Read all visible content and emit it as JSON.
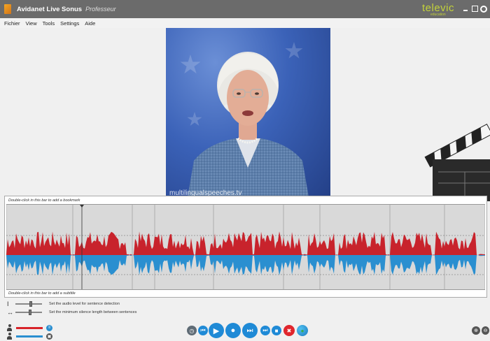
{
  "window": {
    "app_name": "Avidanet Live Sonus",
    "role": "Professeur",
    "brand": "televic",
    "brand_sub": "education"
  },
  "menu": [
    {
      "label": "Fichier"
    },
    {
      "label": "View"
    },
    {
      "label": "Tools"
    },
    {
      "label": "Settings"
    },
    {
      "label": "Aide"
    }
  ],
  "video": {
    "watermark": "multilingualspeeches.tv"
  },
  "waveform": {
    "bookmark_hint": "Double-click in this bar to add a bookmark",
    "subtitle_hint": "Double-click in this bar to add a subtitle"
  },
  "controls": {
    "audio_level_label": "Set the audio level for sentence detection",
    "silence_length_label": "Set the minimum silence length between sentences",
    "audio_level_value": 0.6,
    "silence_length_value": 0.55
  },
  "volume": {
    "row1_color": "#d8232a",
    "row2_color": "#2a8fd0"
  },
  "transport": [
    {
      "icon": "timer-icon",
      "glyph": "◷"
    },
    {
      "icon": "previous-icon",
      "glyph": "⏮"
    },
    {
      "icon": "play-icon",
      "glyph": "▶"
    },
    {
      "icon": "record-icon",
      "glyph": "●"
    },
    {
      "icon": "skip-sentence-icon",
      "glyph": "⏭"
    },
    {
      "icon": "next-icon",
      "glyph": "⏭"
    },
    {
      "icon": "stop-icon",
      "glyph": "■"
    },
    {
      "icon": "delete-icon",
      "glyph": "✖"
    },
    {
      "icon": "globe-icon",
      "glyph": "●"
    }
  ],
  "colors": {
    "wave_top": "#c8232c",
    "wave_bottom": "#2a8fd0",
    "accent_blue": "#1f8ad6",
    "brand_green": "#c3d23a"
  }
}
